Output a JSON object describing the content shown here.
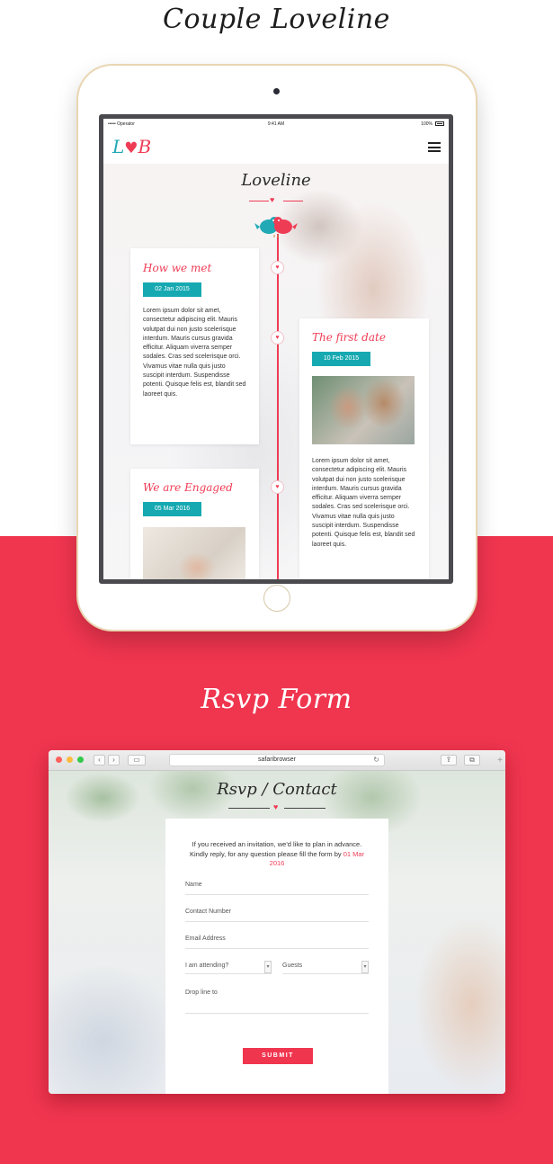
{
  "sections": {
    "loveline_title": "Couple Loveline",
    "rsvp_title": "Rsvp Form"
  },
  "tablet": {
    "status": {
      "carrier": "••••• Operator",
      "time": "9:41 AM",
      "battery": "100%"
    },
    "logo": {
      "left": "L",
      "heart": "♥",
      "right": "B"
    },
    "section_title": "Loveline",
    "events": [
      {
        "title": "How we met",
        "date": "02 Jan 2015",
        "text": "Lorem ipsum dolor sit amet, consectetur adipiscing elit. Mauris volutpat dui non justo scelerisque interdum. Mauris cursus gravida efficitur. Aliquam viverra semper sodales. Cras sed scelerisque orci. Vivamus vitae nulla quis justo suscipit interdum. Suspendisse potenti. Quisque felis est, blandit sed laoreet quis."
      },
      {
        "title": "The first date",
        "date": "10 Feb 2015",
        "text": "Lorem ipsum dolor sit amet, consectetur adipiscing elit. Mauris volutpat dui non justo scelerisque interdum. Mauris cursus gravida efficitur. Aliquam viverra semper sodales. Cras sed scelerisque orci. Vivamus vitae nulla quis justo suscipit interdum. Suspendisse potenti. Quisque felis est, blandit sed laoreet quis."
      },
      {
        "title": "We are Engaged",
        "date": "05 Mar 2016"
      }
    ]
  },
  "browser": {
    "url": "safaribrowser",
    "page_title": "Rsvp / Contact",
    "intro_text": "If you received an invitation, we'd like to plan in advance. Kindly reply, for any question please fill the form by ",
    "intro_date": "01 Mar 2016",
    "fields": {
      "name": "Name",
      "contact": "Contact Number",
      "email": "Email Address",
      "attending": "I am attending?",
      "guests": "Guests",
      "message": "Drop line to"
    },
    "submit_label": "SUBMIT"
  },
  "colors": {
    "accent": "#f0354f",
    "teal": "#16a9b1"
  }
}
